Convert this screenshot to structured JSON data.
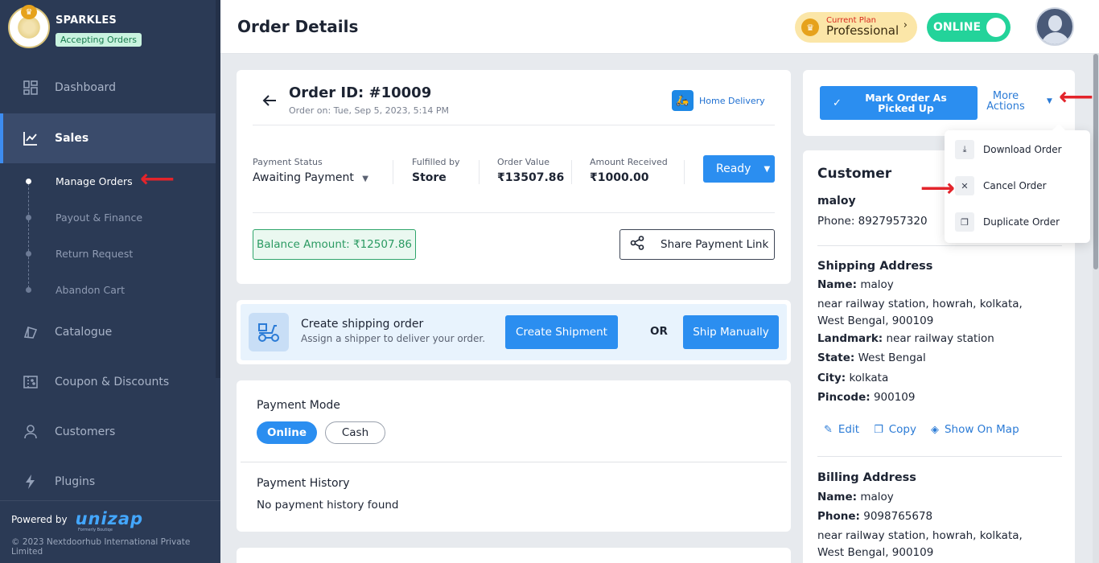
{
  "store": {
    "name": "SPARKLES",
    "status": "Accepting Orders"
  },
  "sidebar": {
    "items": [
      {
        "label": "Dashboard",
        "icon": "dashboard-icon"
      },
      {
        "label": "Sales",
        "icon": "chart-line-icon"
      },
      {
        "label": "Catalogue",
        "icon": "book-icon"
      },
      {
        "label": "Coupon & Discounts",
        "icon": "coupon-icon"
      },
      {
        "label": "Customers",
        "icon": "user-icon"
      },
      {
        "label": "Plugins",
        "icon": "bolt-icon"
      }
    ],
    "sales_sub": [
      "Manage Orders",
      "Payout & Finance",
      "Return Request",
      "Abandon Cart"
    ],
    "powered_by": "Powered by",
    "powered_logo": "unizap",
    "powered_logo_sub": "Formerly Boutiqe",
    "copyright": "© 2023 Nextdoorhub International Private Limited"
  },
  "header": {
    "title": "Order Details",
    "plan_label": "Current Plan",
    "plan_name": "Professional",
    "online_label": "ONLINE"
  },
  "order": {
    "id": "Order ID: #10009",
    "date": "Order on: Tue, Sep 5, 2023, 5:14 PM",
    "delivery_type": "Home Delivery",
    "payment_status_label": "Payment Status",
    "payment_status": "Awaiting Payment",
    "fulfilled_label": "Fulfilled by",
    "fulfilled": "Store",
    "order_value_label": "Order Value",
    "order_value": "₹13507.86",
    "received_label": "Amount Received",
    "received": "₹1000.00",
    "status_button": "Ready",
    "balance": "Balance Amount: ₹12507.86",
    "share_link": "Share Payment Link"
  },
  "shipping": {
    "title": "Create shipping order",
    "subtitle": "Assign a shipper to deliver your order.",
    "create_button": "Create Shipment",
    "or": "OR",
    "manual_button": "Ship Manually"
  },
  "payment": {
    "mode_label": "Payment Mode",
    "modes": [
      "Online",
      "Cash"
    ],
    "history_label": "Payment History",
    "history_empty": "No payment history found"
  },
  "actions": {
    "mark_picked_line1": "Mark Order As",
    "mark_picked_line2": "Picked Up",
    "more_line1": "More",
    "more_line2": "Actions",
    "dropdown": [
      "Download Order",
      "Cancel Order",
      "Duplicate Order"
    ]
  },
  "customer": {
    "title": "Customer",
    "name": "maloy",
    "phone": "Phone: 8927957320",
    "shipping_title": "Shipping Address",
    "ship_name_label": "Name:",
    "ship_name": "maloy",
    "ship_address": "near railway station, howrah, kolkata, West Bengal, 900109",
    "landmark_label": "Landmark:",
    "landmark": "near railway station",
    "state_label": "State:",
    "state": "West Bengal",
    "city_label": "City:",
    "city": "kolkata",
    "pincode_label": "Pincode:",
    "pincode": "900109",
    "edit": "Edit",
    "copy": "Copy",
    "map": "Show On Map",
    "billing_title": "Billing Address",
    "bill_name_label": "Name:",
    "bill_name": "maloy",
    "bill_phone_label": "Phone:",
    "bill_phone": "9098765678",
    "bill_address": "near railway station, howrah, kolkata, West Bengal, 900109"
  },
  "colors": {
    "accent": "#2b8ef0",
    "sidebar": "#2b3a55",
    "success": "#23d39a",
    "annotation": "#e3242b"
  }
}
